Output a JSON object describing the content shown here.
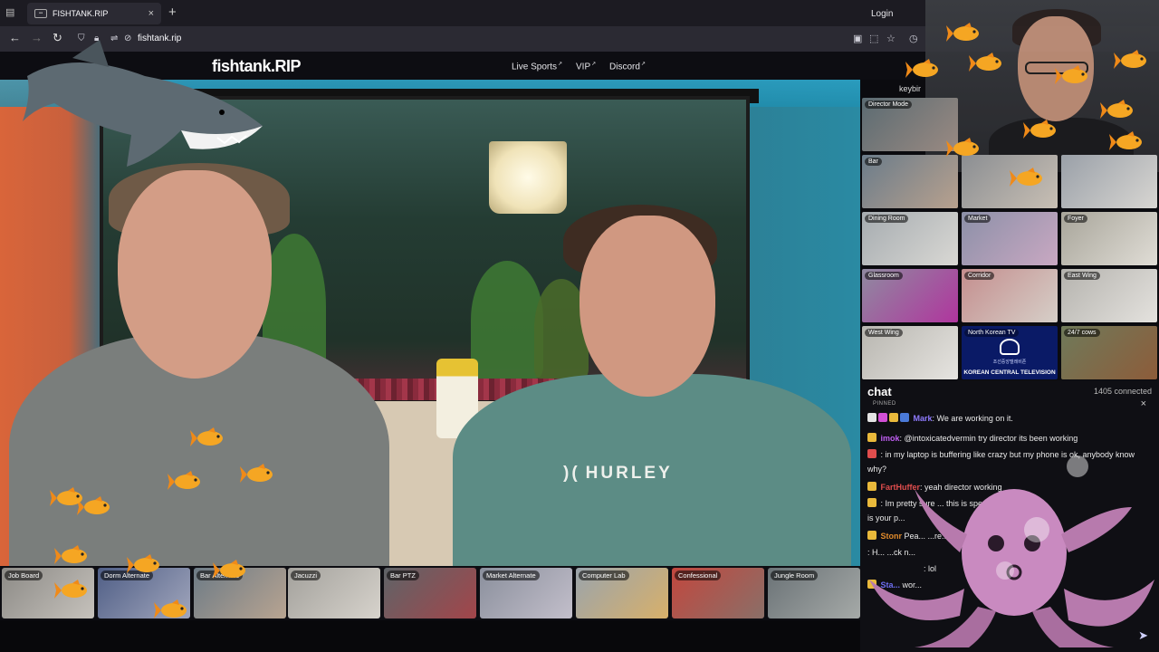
{
  "browser": {
    "tab_title": "FISHTANK.RIP",
    "tab_close": "×",
    "new_tab": "+",
    "url": "fishtank.rip"
  },
  "site": {
    "logo": "fishtank.RIP",
    "nav": [
      {
        "label": "Live Sports"
      },
      {
        "label": "VIP"
      },
      {
        "label": "Discord"
      }
    ],
    "external_mark": "↗",
    "login": "Login",
    "keybind": "keybir"
  },
  "main_video": {
    "shirt_text": "HURLEY"
  },
  "cameras": [
    {
      "label": "Director Mode"
    },
    {
      "label": "Bar"
    },
    {
      "label": ""
    },
    {
      "label": ""
    },
    {
      "label": "Dining Room"
    },
    {
      "label": "Market"
    },
    {
      "label": "Foyer"
    },
    {
      "label": "Glassroom"
    },
    {
      "label": "Corridor"
    },
    {
      "label": "East Wing"
    },
    {
      "label": "West Wing"
    },
    {
      "label": "North Korean TV",
      "brand": "KOREAN CENTRAL TELEVISION",
      "korean": "조선중앙텔레비죤"
    },
    {
      "label": "24/7 cows"
    }
  ],
  "chat": {
    "title": "chat",
    "connected": "1405 connected",
    "pinned_label": "PINNED",
    "close": "×",
    "messages": [
      {
        "user": "Mark",
        "text": ": We are working on it.",
        "color": "#8f7bff"
      },
      {
        "user": "imok",
        "text": ": @intoxicatedvermin try director its been working",
        "color": "#c05ef2"
      },
      {
        "user": "",
        "text": ": in my laptop is buffering like crazy but my phone is ok, anybody know why?",
        "color": "#e04d4d"
      },
      {
        "user": "FartHuffer",
        "text": ": yeah director working",
        "color": "#e04d4d"
      },
      {
        "user": "",
        "text": ": Im pretty sure ... this is specia... ...t",
        "color": "#c9a44a"
      },
      {
        "user": "",
        "text": "is your p...",
        "color": "#c9a44a"
      },
      {
        "user": "Stonr",
        "text": " Pea... ...re...",
        "color": "#e08a2b"
      },
      {
        "user": "",
        "text": ": H... ...ck n...",
        "color": "#888"
      },
      {
        "user": "",
        "text": ": lol",
        "color": "#888"
      },
      {
        "user": "Sta...",
        "text": " wor...",
        "color": "#6e6ef2"
      }
    ]
  },
  "bottom_cams": [
    {
      "label": "Job Board"
    },
    {
      "label": "Dorm Alternate"
    },
    {
      "label": "Bar Alternate"
    },
    {
      "label": "Jacuzzi"
    },
    {
      "label": "Bar PTZ"
    },
    {
      "label": "Market Alternate"
    },
    {
      "label": "Computer Lab"
    },
    {
      "label": "Confessional"
    },
    {
      "label": "Jungle Room"
    }
  ],
  "icons": {
    "back": "arrow-left-icon",
    "forward": "arrow-right-icon",
    "reload": "reload-icon",
    "shield": "shield-icon",
    "lock": "lock-icon",
    "bookmark": "star-icon",
    "send": "send-icon"
  }
}
